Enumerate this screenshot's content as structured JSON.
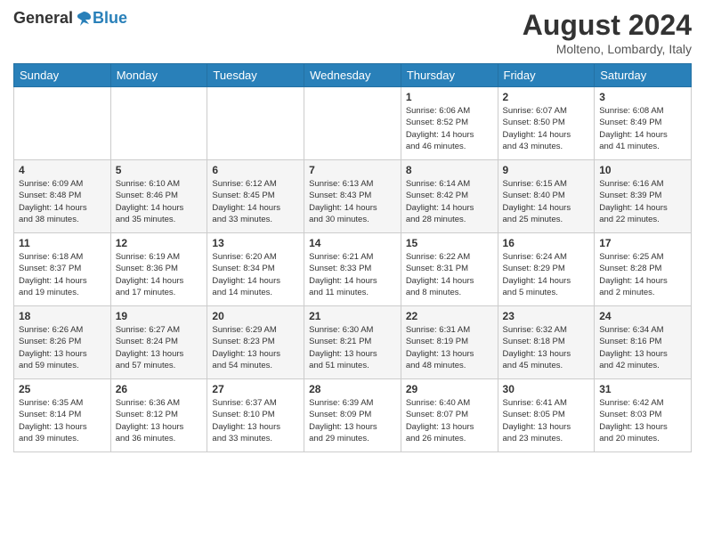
{
  "header": {
    "logo_general": "General",
    "logo_blue": "Blue",
    "month_title": "August 2024",
    "subtitle": "Molteno, Lombardy, Italy"
  },
  "days_of_week": [
    "Sunday",
    "Monday",
    "Tuesday",
    "Wednesday",
    "Thursday",
    "Friday",
    "Saturday"
  ],
  "weeks": [
    [
      {
        "day": "",
        "info": ""
      },
      {
        "day": "",
        "info": ""
      },
      {
        "day": "",
        "info": ""
      },
      {
        "day": "",
        "info": ""
      },
      {
        "day": "1",
        "info": "Sunrise: 6:06 AM\nSunset: 8:52 PM\nDaylight: 14 hours\nand 46 minutes."
      },
      {
        "day": "2",
        "info": "Sunrise: 6:07 AM\nSunset: 8:50 PM\nDaylight: 14 hours\nand 43 minutes."
      },
      {
        "day": "3",
        "info": "Sunrise: 6:08 AM\nSunset: 8:49 PM\nDaylight: 14 hours\nand 41 minutes."
      }
    ],
    [
      {
        "day": "4",
        "info": "Sunrise: 6:09 AM\nSunset: 8:48 PM\nDaylight: 14 hours\nand 38 minutes."
      },
      {
        "day": "5",
        "info": "Sunrise: 6:10 AM\nSunset: 8:46 PM\nDaylight: 14 hours\nand 35 minutes."
      },
      {
        "day": "6",
        "info": "Sunrise: 6:12 AM\nSunset: 8:45 PM\nDaylight: 14 hours\nand 33 minutes."
      },
      {
        "day": "7",
        "info": "Sunrise: 6:13 AM\nSunset: 8:43 PM\nDaylight: 14 hours\nand 30 minutes."
      },
      {
        "day": "8",
        "info": "Sunrise: 6:14 AM\nSunset: 8:42 PM\nDaylight: 14 hours\nand 28 minutes."
      },
      {
        "day": "9",
        "info": "Sunrise: 6:15 AM\nSunset: 8:40 PM\nDaylight: 14 hours\nand 25 minutes."
      },
      {
        "day": "10",
        "info": "Sunrise: 6:16 AM\nSunset: 8:39 PM\nDaylight: 14 hours\nand 22 minutes."
      }
    ],
    [
      {
        "day": "11",
        "info": "Sunrise: 6:18 AM\nSunset: 8:37 PM\nDaylight: 14 hours\nand 19 minutes."
      },
      {
        "day": "12",
        "info": "Sunrise: 6:19 AM\nSunset: 8:36 PM\nDaylight: 14 hours\nand 17 minutes."
      },
      {
        "day": "13",
        "info": "Sunrise: 6:20 AM\nSunset: 8:34 PM\nDaylight: 14 hours\nand 14 minutes."
      },
      {
        "day": "14",
        "info": "Sunrise: 6:21 AM\nSunset: 8:33 PM\nDaylight: 14 hours\nand 11 minutes."
      },
      {
        "day": "15",
        "info": "Sunrise: 6:22 AM\nSunset: 8:31 PM\nDaylight: 14 hours\nand 8 minutes."
      },
      {
        "day": "16",
        "info": "Sunrise: 6:24 AM\nSunset: 8:29 PM\nDaylight: 14 hours\nand 5 minutes."
      },
      {
        "day": "17",
        "info": "Sunrise: 6:25 AM\nSunset: 8:28 PM\nDaylight: 14 hours\nand 2 minutes."
      }
    ],
    [
      {
        "day": "18",
        "info": "Sunrise: 6:26 AM\nSunset: 8:26 PM\nDaylight: 13 hours\nand 59 minutes."
      },
      {
        "day": "19",
        "info": "Sunrise: 6:27 AM\nSunset: 8:24 PM\nDaylight: 13 hours\nand 57 minutes."
      },
      {
        "day": "20",
        "info": "Sunrise: 6:29 AM\nSunset: 8:23 PM\nDaylight: 13 hours\nand 54 minutes."
      },
      {
        "day": "21",
        "info": "Sunrise: 6:30 AM\nSunset: 8:21 PM\nDaylight: 13 hours\nand 51 minutes."
      },
      {
        "day": "22",
        "info": "Sunrise: 6:31 AM\nSunset: 8:19 PM\nDaylight: 13 hours\nand 48 minutes."
      },
      {
        "day": "23",
        "info": "Sunrise: 6:32 AM\nSunset: 8:18 PM\nDaylight: 13 hours\nand 45 minutes."
      },
      {
        "day": "24",
        "info": "Sunrise: 6:34 AM\nSunset: 8:16 PM\nDaylight: 13 hours\nand 42 minutes."
      }
    ],
    [
      {
        "day": "25",
        "info": "Sunrise: 6:35 AM\nSunset: 8:14 PM\nDaylight: 13 hours\nand 39 minutes."
      },
      {
        "day": "26",
        "info": "Sunrise: 6:36 AM\nSunset: 8:12 PM\nDaylight: 13 hours\nand 36 minutes."
      },
      {
        "day": "27",
        "info": "Sunrise: 6:37 AM\nSunset: 8:10 PM\nDaylight: 13 hours\nand 33 minutes."
      },
      {
        "day": "28",
        "info": "Sunrise: 6:39 AM\nSunset: 8:09 PM\nDaylight: 13 hours\nand 29 minutes."
      },
      {
        "day": "29",
        "info": "Sunrise: 6:40 AM\nSunset: 8:07 PM\nDaylight: 13 hours\nand 26 minutes."
      },
      {
        "day": "30",
        "info": "Sunrise: 6:41 AM\nSunset: 8:05 PM\nDaylight: 13 hours\nand 23 minutes."
      },
      {
        "day": "31",
        "info": "Sunrise: 6:42 AM\nSunset: 8:03 PM\nDaylight: 13 hours\nand 20 minutes."
      }
    ]
  ]
}
